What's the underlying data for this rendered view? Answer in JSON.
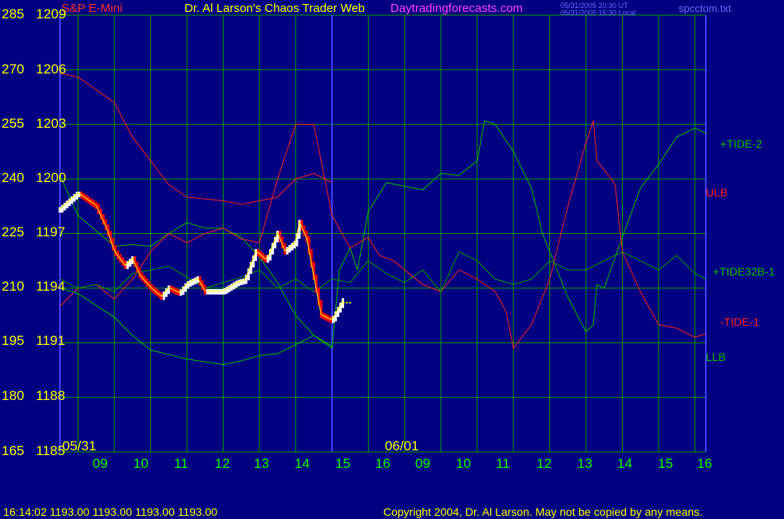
{
  "header": {
    "symbol": "S&P E-Mini",
    "title": "Dr. Al Larson's Chaos Trader Web",
    "site": "Daytradingforecasts.com",
    "time_utc": "05/31/2005 20:30 UT",
    "time_local": "05/31/2005 15:30 Local",
    "file": "spcctom.txt"
  },
  "footer": {
    "quote": "16:14:02  1193.00 1193.00 1193.00 1193.00",
    "copyright": "Copyright 2004, Dr. Al Larson. May not be copied by any means."
  },
  "colors": {
    "background": "#000080",
    "grid": "#00a000",
    "price_up": "#ffffff",
    "price_down": "#ff0000",
    "ema": "#ffff00",
    "tide": "#ff2020",
    "bands": "#00c000",
    "axis_labels": "#ffff00",
    "time_labels": "#00ff00"
  },
  "chart_data": {
    "type": "line",
    "y_left_label_ticks": [
      "285",
      "270",
      "255",
      "240",
      "225",
      "210",
      "195",
      "180",
      "165"
    ],
    "y_right_label_ticks": [
      "1209",
      "1206",
      "1203",
      "1200",
      "1197",
      "1194",
      "1191",
      "1188",
      "1185"
    ],
    "ylim_price": [
      1185,
      1209
    ],
    "ylim_index": [
      165,
      285
    ],
    "x_ticks": [
      "09",
      "10",
      "11",
      "12",
      "13",
      "14",
      "15",
      "16",
      "09",
      "10",
      "11",
      "12",
      "13",
      "14",
      "15",
      "16"
    ],
    "date_markers": [
      "05/31",
      "06/01"
    ],
    "x_range_hours": [
      8.5,
      16
    ],
    "series": [
      {
        "name": "+TIDE-2",
        "color": "#00c000",
        "points": [
          [
            8.5,
            1200.2
          ],
          [
            9,
            1198
          ],
          [
            10,
            1196.3
          ],
          [
            10.5,
            1196.4
          ],
          [
            11,
            1196.3
          ],
          [
            11.5,
            1197
          ],
          [
            12,
            1197.6
          ],
          [
            12.5,
            1197.3
          ],
          [
            13,
            1197.3
          ],
          [
            13.5,
            1196.8
          ],
          [
            14,
            1195.7
          ],
          [
            14.5,
            1194.3
          ],
          [
            15,
            1192.5
          ],
          [
            15.5,
            1191.4
          ],
          [
            16,
            1190.7
          ],
          [
            16.2,
            1195
          ],
          [
            16.5,
            1196.2
          ],
          [
            16.7,
            1195
          ],
          [
            17,
            1198.2
          ],
          [
            17.5,
            1199.8
          ],
          [
            18,
            1199.6
          ],
          [
            18.5,
            1199.4
          ],
          [
            19,
            1200.3
          ],
          [
            19.5,
            1200.2
          ],
          [
            20,
            1201
          ],
          [
            20.2,
            1203.2
          ],
          [
            20.5,
            1203
          ],
          [
            21,
            1201.5
          ],
          [
            21.5,
            1199.5
          ],
          [
            21.8,
            1197
          ],
          [
            22.3,
            1194.5
          ],
          [
            22.5,
            1193.5
          ],
          [
            23,
            1191.6
          ],
          [
            23.2,
            1192
          ],
          [
            23.3,
            1194.2
          ],
          [
            23.5,
            1194
          ],
          [
            24,
            1196.8
          ],
          [
            24.5,
            1199.5
          ],
          [
            25,
            1200.8
          ],
          [
            25.5,
            1202.3
          ],
          [
            26,
            1202.8
          ],
          [
            26.3,
            1202.5
          ]
        ]
      },
      {
        "name": "ULB",
        "color": "#ff2020",
        "points": [
          [
            8.5,
            1205.8
          ],
          [
            9,
            1205.6
          ],
          [
            10,
            1204.2
          ],
          [
            10.5,
            1202.3
          ],
          [
            11,
            1201
          ],
          [
            11.5,
            1199.7
          ],
          [
            12,
            1199
          ],
          [
            13,
            1198.8
          ],
          [
            13.5,
            1198.6
          ],
          [
            14,
            1198.8
          ],
          [
            14.5,
            1199
          ],
          [
            15,
            1200
          ],
          [
            15.5,
            1200.3
          ],
          [
            16,
            1199.8
          ]
        ]
      },
      {
        "name": "-TIDE-1",
        "color": "#ff2020",
        "points": [
          [
            8.5,
            1193
          ],
          [
            9,
            1194
          ],
          [
            9.5,
            1194.2
          ],
          [
            10,
            1193.4
          ],
          [
            10.5,
            1194.5
          ],
          [
            11,
            1196
          ],
          [
            11.5,
            1197
          ],
          [
            12,
            1196.5
          ],
          [
            12.5,
            1197
          ],
          [
            13,
            1197.3
          ],
          [
            13.5,
            1196.7
          ],
          [
            14,
            1196.5
          ],
          [
            14.5,
            1200
          ],
          [
            15,
            1203
          ],
          [
            15.5,
            1203
          ],
          [
            16,
            1198
          ],
          [
            16.5,
            1196.2
          ],
          [
            17,
            1196.8
          ],
          [
            17.3,
            1195.8
          ],
          [
            17.7,
            1195.5
          ],
          [
            18,
            1195
          ],
          [
            18.5,
            1194.2
          ],
          [
            19,
            1193.8
          ],
          [
            19.5,
            1195
          ],
          [
            20,
            1194.5
          ],
          [
            20.5,
            1193.8
          ],
          [
            20.8,
            1192.7
          ],
          [
            21,
            1190.7
          ],
          [
            21.5,
            1192
          ],
          [
            22,
            1194.5
          ],
          [
            22.5,
            1198.5
          ],
          [
            23,
            1202
          ],
          [
            23.2,
            1203.2
          ],
          [
            23.3,
            1201
          ],
          [
            23.5,
            1200.5
          ],
          [
            23.8,
            1199.7
          ],
          [
            24,
            1196
          ],
          [
            24.5,
            1193.8
          ],
          [
            25,
            1192
          ],
          [
            25.5,
            1191.8
          ],
          [
            26,
            1191.3
          ],
          [
            26.3,
            1191.5
          ]
        ]
      },
      {
        "name": "+TIDE32B-1",
        "color": "#00a000",
        "points": [
          [
            8.5,
            1194.5
          ],
          [
            9,
            1194
          ],
          [
            9.5,
            1194.2
          ],
          [
            10,
            1193.8
          ],
          [
            10.5,
            1194.8
          ],
          [
            11,
            1195
          ],
          [
            11.5,
            1195.2
          ],
          [
            12,
            1194.6
          ],
          [
            12.5,
            1194
          ],
          [
            13,
            1194.3
          ],
          [
            13.5,
            1194.6
          ],
          [
            14,
            1195
          ],
          [
            14.5,
            1194
          ],
          [
            15,
            1194.5
          ],
          [
            15.5,
            1193.8
          ],
          [
            16,
            1194.5
          ],
          [
            16.5,
            1194.3
          ],
          [
            17,
            1195.5
          ],
          [
            17.5,
            1194.8
          ],
          [
            18,
            1194.3
          ],
          [
            18.5,
            1195
          ],
          [
            19,
            1193.8
          ],
          [
            19.5,
            1196
          ],
          [
            20,
            1195.5
          ],
          [
            20.5,
            1194.5
          ],
          [
            21,
            1194.2
          ],
          [
            21.5,
            1194.5
          ],
          [
            22,
            1195.5
          ],
          [
            22.5,
            1195
          ],
          [
            23,
            1195
          ],
          [
            23.5,
            1195.5
          ],
          [
            24,
            1196
          ],
          [
            24.5,
            1195.5
          ],
          [
            25,
            1195
          ],
          [
            25.5,
            1195.8
          ],
          [
            26,
            1194.8
          ],
          [
            26.3,
            1194.5
          ]
        ]
      },
      {
        "name": "LLB",
        "color": "#00c000",
        "points": [
          [
            8.5,
            1194
          ],
          [
            9,
            1193.7
          ],
          [
            10,
            1192.4
          ],
          [
            10.5,
            1191.4
          ],
          [
            11,
            1190.6
          ],
          [
            12,
            1190.1
          ],
          [
            13,
            1189.8
          ],
          [
            13.5,
            1190
          ],
          [
            14,
            1190.3
          ],
          [
            14.5,
            1190.4
          ],
          [
            15,
            1190.9
          ],
          [
            15.5,
            1191.4
          ],
          [
            16,
            1190.8
          ]
        ]
      },
      {
        "name": "Price",
        "color": "#ff0000",
        "points": [
          [
            8.5,
            1198.3
          ],
          [
            9,
            1199.2
          ],
          [
            9.5,
            1198.5
          ],
          [
            9.8,
            1197.2
          ],
          [
            10,
            1196
          ],
          [
            10.3,
            1195.2
          ],
          [
            10.5,
            1195.6
          ],
          [
            10.7,
            1194.7
          ],
          [
            11,
            1194
          ],
          [
            11.3,
            1193.5
          ],
          [
            11.5,
            1194
          ],
          [
            11.8,
            1193.7
          ],
          [
            12,
            1194.2
          ],
          [
            12.3,
            1194.5
          ],
          [
            12.5,
            1193.8
          ],
          [
            13,
            1193.8
          ],
          [
            13.4,
            1194.3
          ],
          [
            13.6,
            1194.4
          ],
          [
            13.9,
            1196
          ],
          [
            14.2,
            1195.5
          ],
          [
            14.5,
            1197
          ],
          [
            14.7,
            1196
          ],
          [
            15,
            1196.5
          ],
          [
            15.1,
            1197.6
          ],
          [
            15.3,
            1196.7
          ],
          [
            15.5,
            1194.6
          ],
          [
            15.7,
            1192.5
          ],
          [
            16,
            1192.2
          ],
          [
            16.3,
            1193.3
          ]
        ]
      }
    ]
  }
}
